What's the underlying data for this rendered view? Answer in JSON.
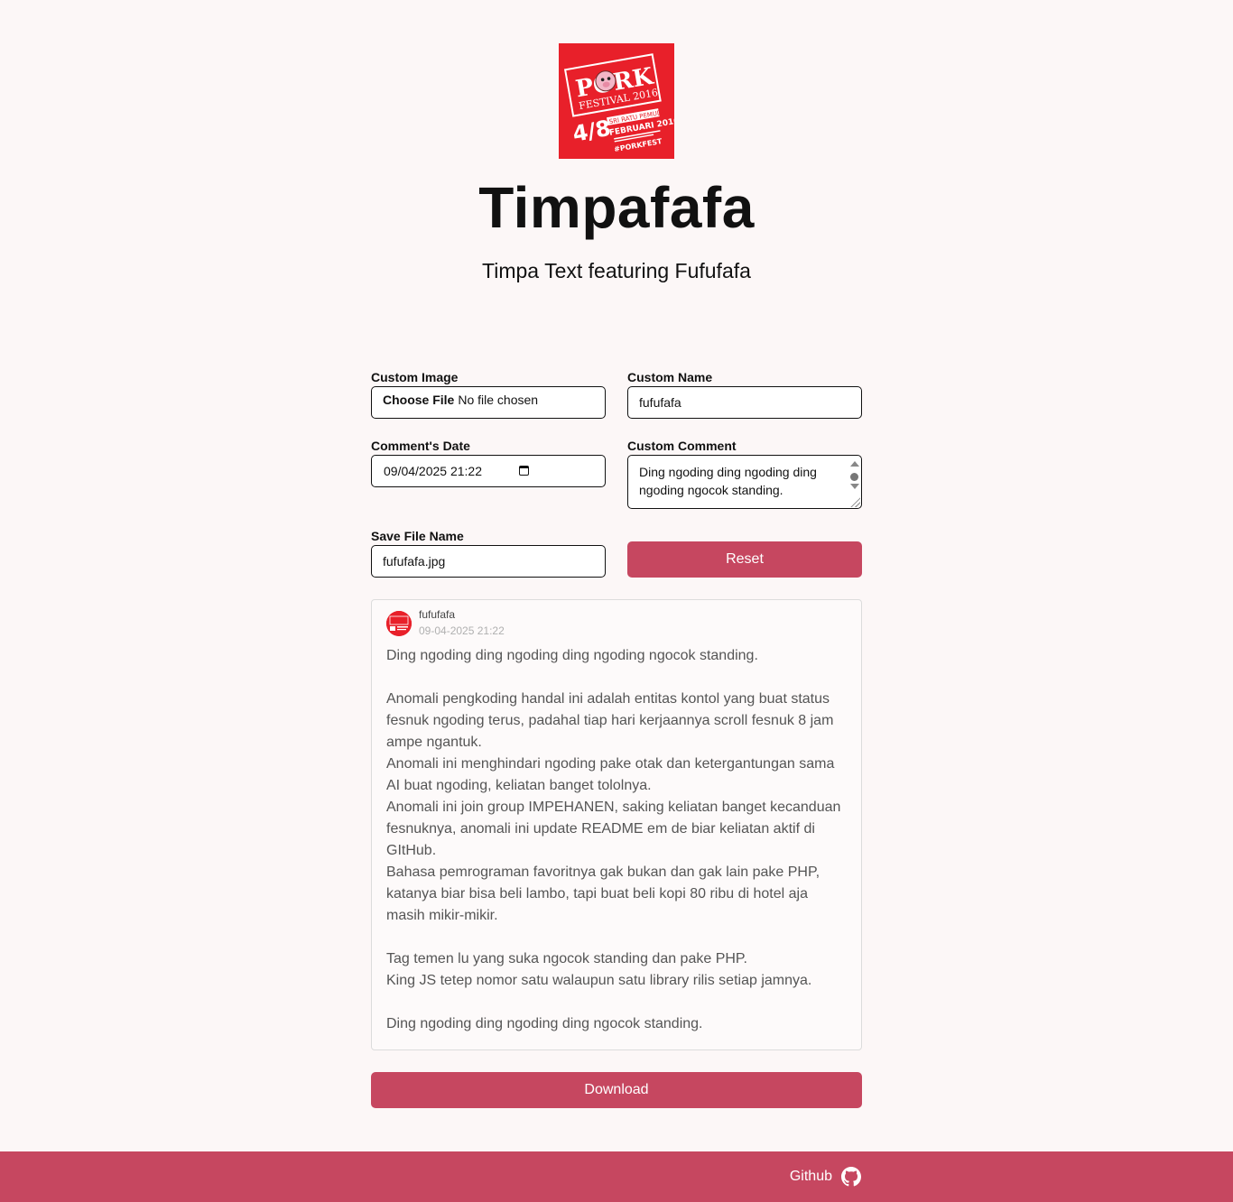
{
  "header": {
    "logo": {
      "line1": "PORK",
      "line2": "FESTIVAL 2016",
      "date": "4/8",
      "venue": "SRI RATU PEMUDA",
      "month": "FEBRUARI 2016",
      "tag": "#PORKFEST"
    },
    "title": "Timpafafa",
    "subtitle": "Timpa Text featuring Fufufafa"
  },
  "form": {
    "custom_image": {
      "label": "Custom Image",
      "button": "Choose File",
      "status": "No file chosen"
    },
    "custom_name": {
      "label": "Custom Name",
      "value": "fufufafa"
    },
    "comment_date": {
      "label": "Comment's Date",
      "value": "09/04/2025 21:22"
    },
    "custom_comment": {
      "label": "Custom Comment",
      "value": "Ding ngoding ding ngoding ding ngoding ngocok standing."
    },
    "save_file_name": {
      "label": "Save File Name",
      "value": "fufufafa.jpg"
    },
    "reset_label": "Reset"
  },
  "preview": {
    "name": "fufufafa",
    "date": "09-04-2025 21:22",
    "paragraphs": [
      "Ding ngoding ding ngoding ding ngoding ngocok standing.",
      "Anomali pengkoding handal ini adalah entitas kontol yang buat status fesnuk ngoding terus, padahal tiap hari kerjaannya scroll fesnuk 8 jam ampe ngantuk.",
      "Anomali ini menghindari ngoding pake otak dan ketergantungan sama AI buat ngoding, keliatan banget tololnya.",
      "Anomali ini join group IMPEHANEN, saking keliatan banget kecanduan fesnuknya, anomali ini update README em de biar keliatan aktif di GItHub.",
      "Bahasa pemrograman favoritnya gak bukan dan gak lain pake PHP, katanya biar bisa beli lambo, tapi buat beli kopi 80 ribu di hotel aja masih mikir-mikir.",
      "Tag temen lu yang suka ngocok standing dan pake PHP.",
      "King JS tetep nomor satu walaupun satu library rilis setiap jamnya.",
      "Ding ngoding ding ngoding ding ngocok standing."
    ]
  },
  "download_label": "Download",
  "footer": {
    "github_label": "Github",
    "icon": "github-icon"
  },
  "colors": {
    "accent": "#c64760",
    "background": "#fcf7f7",
    "logo_red": "#e8202a"
  }
}
